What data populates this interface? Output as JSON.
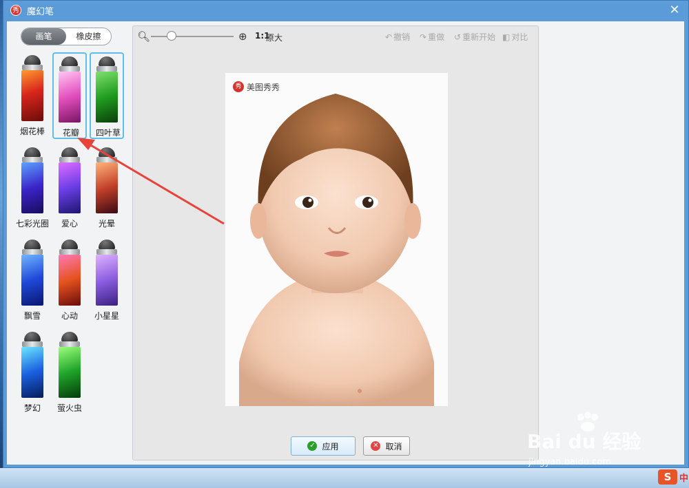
{
  "window": {
    "title": "魔幻笔",
    "app_icon_glyph": "秀",
    "close_glyph": "✕"
  },
  "mode_toggle": {
    "brush_label": "画笔",
    "eraser_label": "橡皮擦",
    "active": "brush"
  },
  "brushes": [
    {
      "label": "烟花棒",
      "selected": false,
      "gradient": "linear-gradient(160deg,#ff9a2e,#d8251c 45%,#6b0c0a)"
    },
    {
      "label": "花瓣",
      "selected": true,
      "gradient": "linear-gradient(160deg,#ffc6f3,#e24fbd 50%,#7a1462)"
    },
    {
      "label": "四叶草",
      "selected": true,
      "gradient": "linear-gradient(160deg,#7fe06f,#1f9c1f 50%,#0b3e0b)"
    },
    {
      "label": "七彩光圈",
      "selected": false,
      "gradient": "linear-gradient(160deg,#5aa2ff,#3b24c8 50%,#180b5c)"
    },
    {
      "label": "爱心",
      "selected": false,
      "gradient": "linear-gradient(160deg,#e06cff,#6b3ee6 50%,#1c1670)"
    },
    {
      "label": "光晕",
      "selected": false,
      "gradient": "linear-gradient(160deg,#ffb47a,#c2402a 50%,#3a0b12)"
    },
    {
      "label": "飘雪",
      "selected": false,
      "gradient": "linear-gradient(160deg,#6fb5ff,#1f48d8 50%,#0a1670)"
    },
    {
      "label": "心动",
      "selected": false,
      "gradient": "linear-gradient(160deg,#ff7ab8,#e5521e 50%,#6a0c0c)"
    },
    {
      "label": "小星星",
      "selected": false,
      "gradient": "linear-gradient(160deg,#e0b2ff,#8a5ee0 50%,#3a2080)"
    },
    {
      "label": "梦幻",
      "selected": false,
      "gradient": "linear-gradient(160deg,#6ae6ff,#1a60e0 50%,#061a5a)"
    },
    {
      "label": "萤火虫",
      "selected": false,
      "gradient": "linear-gradient(160deg,#9cff7a,#1fa32a 50%,#053a0a)"
    }
  ],
  "toolbar": {
    "ratio": "1:1",
    "ratio_suffix": "原大",
    "undo": "撤销",
    "redo": "重做",
    "restart": "重新开始",
    "compare": "对比",
    "zoom": 0.25
  },
  "photo": {
    "watermark_logo": "秀",
    "watermark_text": "美图秀秀"
  },
  "buttons": {
    "apply": "应用",
    "cancel": "取消"
  },
  "baidu": {
    "main": "Bai du 经验",
    "sub": "jingyan.baidu.com"
  },
  "taskbar": {
    "ime_logo": "S",
    "ime_lang": "中"
  },
  "colors": {
    "accent": "#5dbfe8",
    "arrow": "#e8433a",
    "titlebar": "#5b9bd8"
  }
}
